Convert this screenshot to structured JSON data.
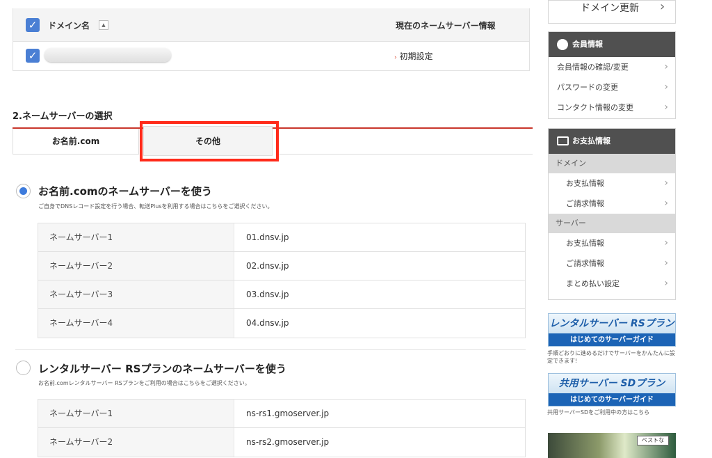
{
  "domain_table": {
    "col_domain": "ドメイン名",
    "col_ns": "現在のネームサーバー情報",
    "row_action": "初期設定"
  },
  "section": {
    "title": "2.ネームサーバーの選択",
    "tabs": [
      "お名前.com",
      "その他"
    ]
  },
  "option1": {
    "title": "お名前.comのネームサーバーを使う",
    "note": "ご自身でDNSレコード設定を行う場合、転送Plusを利用する場合はこちらをご選択ください。",
    "rows": [
      {
        "key": "ネームサーバー1",
        "val": "01.dnsv.jp"
      },
      {
        "key": "ネームサーバー2",
        "val": "02.dnsv.jp"
      },
      {
        "key": "ネームサーバー3",
        "val": "03.dnsv.jp"
      },
      {
        "key": "ネームサーバー4",
        "val": "04.dnsv.jp"
      }
    ]
  },
  "option2": {
    "title": "レンタルサーバー RSプランのネームサーバーを使う",
    "note": "お名前.comレンタルサーバー RSプランをご利用の場合はこちらをご選択ください。",
    "rows": [
      {
        "key": "ネームサーバー1",
        "val": "ns-rs1.gmoserver.jp"
      },
      {
        "key": "ネームサーバー2",
        "val": "ns-rs2.gmoserver.jp"
      }
    ]
  },
  "sidebar": {
    "domain_renew": "ドメイン更新",
    "member_head": "会員情報",
    "member_items": [
      "会員情報の確認/変更",
      "パスワードの変更",
      "コンタクト情報の変更"
    ],
    "payment_head": "お支払情報",
    "group_domain": "ドメイン",
    "domain_items": [
      "お支払情報",
      "ご請求情報"
    ],
    "group_server": "サーバー",
    "server_items": [
      "お支払情報",
      "ご請求情報",
      "まとめ払い設定"
    ]
  },
  "banners": [
    {
      "top": "レンタルサーバー RSプラン",
      "bottom": "はじめてのサーバーガイド",
      "note": "手順どおりに進めるだけでサーバーをかんたんに設定できます!"
    },
    {
      "top": "共用サーバー SDプラン",
      "bottom": "はじめてのサーバーガイド",
      "note": "共用サーバーSDをご利用中の方はこちら"
    }
  ],
  "banner3_label": "ベストな",
  "colors": {
    "accent": "#3d7bdc",
    "highlight": "#ff2a1a",
    "tab_line": "#c9362b",
    "sidebar_head": "#505050"
  }
}
